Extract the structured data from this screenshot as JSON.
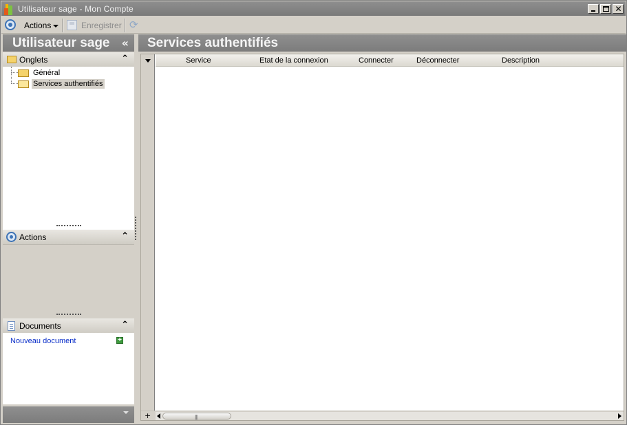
{
  "window": {
    "title": "Utilisateur sage",
    "separator": " - ",
    "subtitle": "Mon Compte"
  },
  "toolbar": {
    "actions_label": "Actions",
    "save_label": "Enregistrer"
  },
  "left_panel": {
    "title": "Utilisateur sage",
    "collapse_glyph": "«",
    "sections": {
      "onglets": {
        "title": "Onglets",
        "chevron": "⌃"
      },
      "actions": {
        "title": "Actions",
        "chevron": "⌃"
      },
      "documents": {
        "title": "Documents",
        "chevron": "⌃"
      }
    },
    "tree": [
      {
        "label": "Général",
        "selected": false
      },
      {
        "label": "Services authentifiés",
        "selected": true
      }
    ],
    "documents": {
      "new_link": "Nouveau document",
      "add_glyph": "+"
    }
  },
  "main": {
    "title": "Services authentifiés",
    "columns": [
      "Service",
      "Etat de la connexion",
      "Connecter",
      "Déconnecter",
      "Description"
    ],
    "add_row_glyph": "+",
    "scroll_grip": "|||"
  },
  "icons": {
    "close_glyph": "✕",
    "refresh_glyph": "⟳"
  },
  "colors": {
    "header_gray": "#858585",
    "link_blue": "#0b2fc9",
    "accent_blue": "#3e73b5"
  }
}
